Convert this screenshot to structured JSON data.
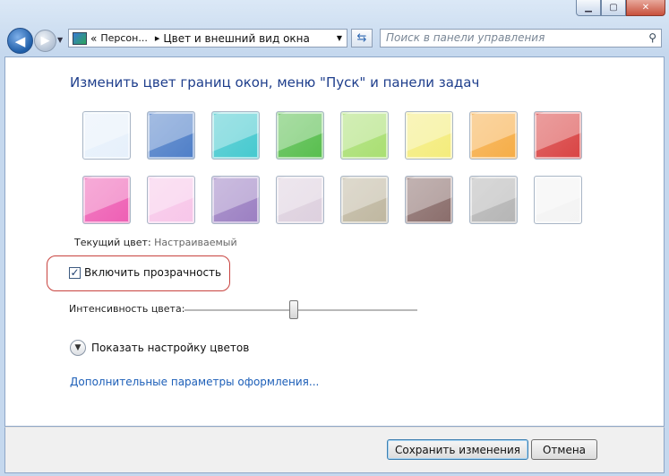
{
  "window": {
    "caption_buttons": [
      "minimize-icon",
      "maximize-icon",
      "close-icon"
    ]
  },
  "navbar": {
    "breadcrumb_prefix": "«",
    "breadcrumb_parent": "Персон...",
    "breadcrumb_separator": "▸",
    "breadcrumb_current": "Цвет и внешний вид окна",
    "search_placeholder": "Поиск в панели управления"
  },
  "content": {
    "heading": "Изменить цвет границ окон, меню \"Пуск\" и панели задач",
    "swatches": [
      {
        "color": "#e6f0fb"
      },
      {
        "color": "#4f7fc8"
      },
      {
        "color": "#46c9cf"
      },
      {
        "color": "#58be4e"
      },
      {
        "color": "#a9df72"
      },
      {
        "color": "#f4ec7c"
      },
      {
        "color": "#f6ad47"
      },
      {
        "color": "#d94444"
      },
      {
        "color": "#ee5fb4"
      },
      {
        "color": "#f7c6e9"
      },
      {
        "color": "#9b7fc2"
      },
      {
        "color": "#ddd0de"
      },
      {
        "color": "#bfb7a0"
      },
      {
        "color": "#8a6d6b"
      },
      {
        "color": "#b5b5b5"
      },
      {
        "color": "#f3f3f3"
      }
    ],
    "current_color_label": "Текущий цвет:",
    "current_color_value": "Настраиваемый",
    "transparency_label": "Включить прозрачность",
    "transparency_checked": true,
    "intensity_label": "Интенсивность цвета:",
    "intensity_value": 0.47,
    "expander_label": "Показать настройку цветов",
    "advanced_link": "Дополнительные параметры оформления..."
  },
  "footer": {
    "save_label": "Сохранить изменения",
    "cancel_label": "Отмена"
  },
  "colors": {
    "heading": "#1e3e8c",
    "link": "#1d5fb8",
    "highlight_outline": "#c8433f"
  }
}
